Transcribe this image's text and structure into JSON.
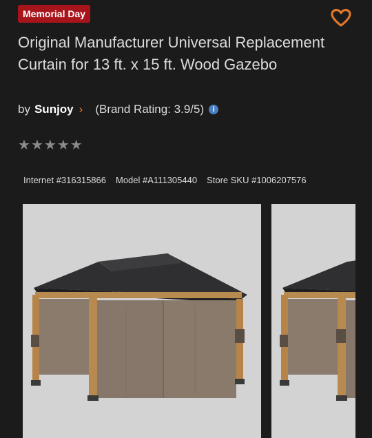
{
  "badge": {
    "label": "Memorial Day",
    "color": "#a8141c"
  },
  "favorite": {
    "icon": "heart-icon",
    "color": "#e0782c"
  },
  "product": {
    "title": "Original Manufacturer Universal Replacement Curtain for 13 ft. x 15 ft. Wood Gazebo",
    "by_label": "by",
    "brand": "Sunjoy",
    "brand_rating": "(Brand Rating: 3.9/5)",
    "info_icon": "info-icon",
    "stars": {
      "filled": 0,
      "total": 5,
      "glyph": "★★★★★"
    }
  },
  "identifiers": {
    "internet": "Internet #316315866",
    "model": "Model #A111305440",
    "store_sku": "Store SKU #1006207576"
  },
  "gallery": {
    "images": [
      {
        "alt": "gazebo-with-curtains-front-view"
      },
      {
        "alt": "gazebo-with-curtains-alternate-view"
      }
    ]
  },
  "colors": {
    "accent": "#e0782c",
    "background": "#1b1b1b",
    "info": "#4a7fc1"
  }
}
